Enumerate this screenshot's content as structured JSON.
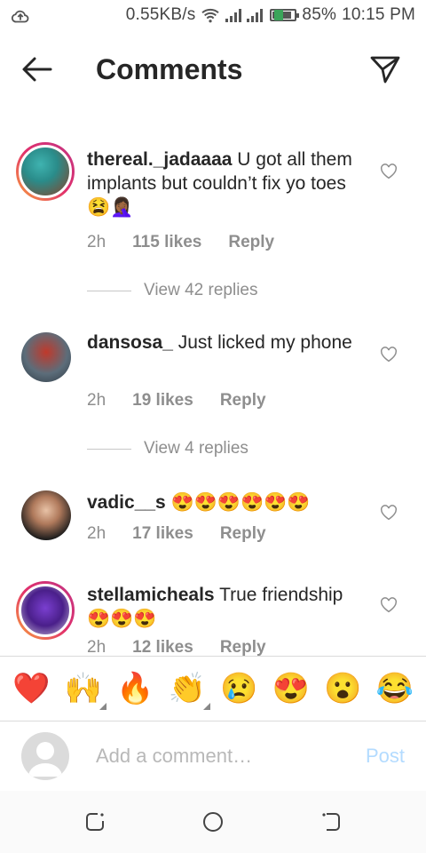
{
  "status": {
    "speed": "0.55KB/s",
    "battery": "85%",
    "time": "10:15 PM",
    "battery_level": 0.85
  },
  "header": {
    "title": "Comments",
    "back_icon": "arrow-left-icon",
    "send_icon": "paper-plane-icon"
  },
  "comments": [
    {
      "username": "thereal._jadaaaa",
      "text": "U got all them implants but couldn’t fix yo toes 😫🤦🏾‍♀️",
      "time": "2h",
      "likes": "115 likes",
      "reply": "Reply",
      "view_replies": "View 42 replies"
    },
    {
      "username": "dansosa_",
      "text": "Just licked my phone",
      "time": "2h",
      "likes": "19 likes",
      "reply": "Reply",
      "view_replies": "View 4 replies"
    },
    {
      "username": "vadic__s",
      "text": "😍😍😍😍😍😍",
      "time": "2h",
      "likes": "17 likes",
      "reply": "Reply"
    },
    {
      "username": "stellamicheals",
      "text": "True friendship😍😍😍",
      "time": "2h",
      "likes": "12 likes",
      "reply": "Reply"
    }
  ],
  "emoji_bar": [
    "❤️",
    "🙌",
    "🔥",
    "👏",
    "😢",
    "😍",
    "😮",
    "😂"
  ],
  "composer": {
    "placeholder": "Add a comment…",
    "post_label": "Post"
  },
  "colors": {
    "post_disabled": "#b3dbff",
    "meta_gray": "#8e8e8e",
    "story_ring": "#e1306c"
  }
}
